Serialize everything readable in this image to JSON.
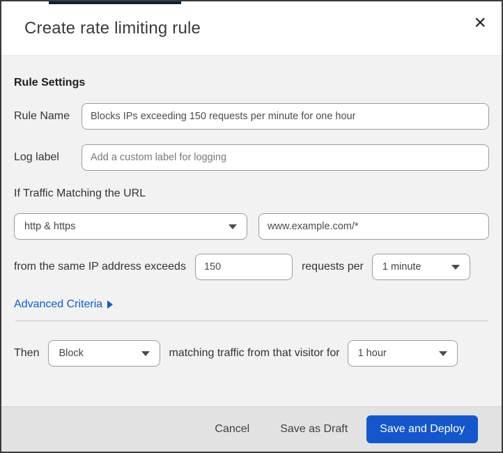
{
  "dialog": {
    "title": "Create rate limiting rule",
    "close_icon": "×"
  },
  "rule_settings": {
    "heading": "Rule Settings",
    "rule_name": {
      "label": "Rule Name",
      "value": "Blocks IPs exceeding 150 requests per minute for one hour"
    },
    "log_label": {
      "label": "Log label",
      "placeholder": "Add a custom label for logging"
    }
  },
  "match": {
    "intro": "If Traffic Matching the URL",
    "scheme_select": {
      "value": "http & https"
    },
    "url_input": {
      "value": "www.example.com/*"
    },
    "exceeds_text": "from the same IP address exceeds",
    "threshold_input": {
      "value": "150"
    },
    "requests_per_text": "requests per",
    "period_select": {
      "value": "1 minute"
    },
    "advanced_link": "Advanced Criteria"
  },
  "action": {
    "then_text": "Then",
    "action_select": {
      "value": "Block"
    },
    "duration_text": "matching traffic from that visitor for",
    "duration_select": {
      "value": "1 hour"
    }
  },
  "footer": {
    "cancel_label": "Cancel",
    "save_draft_label": "Save as Draft",
    "save_deploy_label": "Save and Deploy"
  },
  "colors": {
    "primary_button": "#1457cd",
    "link_blue": "#0a5bd3",
    "top_strip": "#0d2133",
    "body_background": "#f2f2f2",
    "footer_background": "#e2e2e2"
  }
}
